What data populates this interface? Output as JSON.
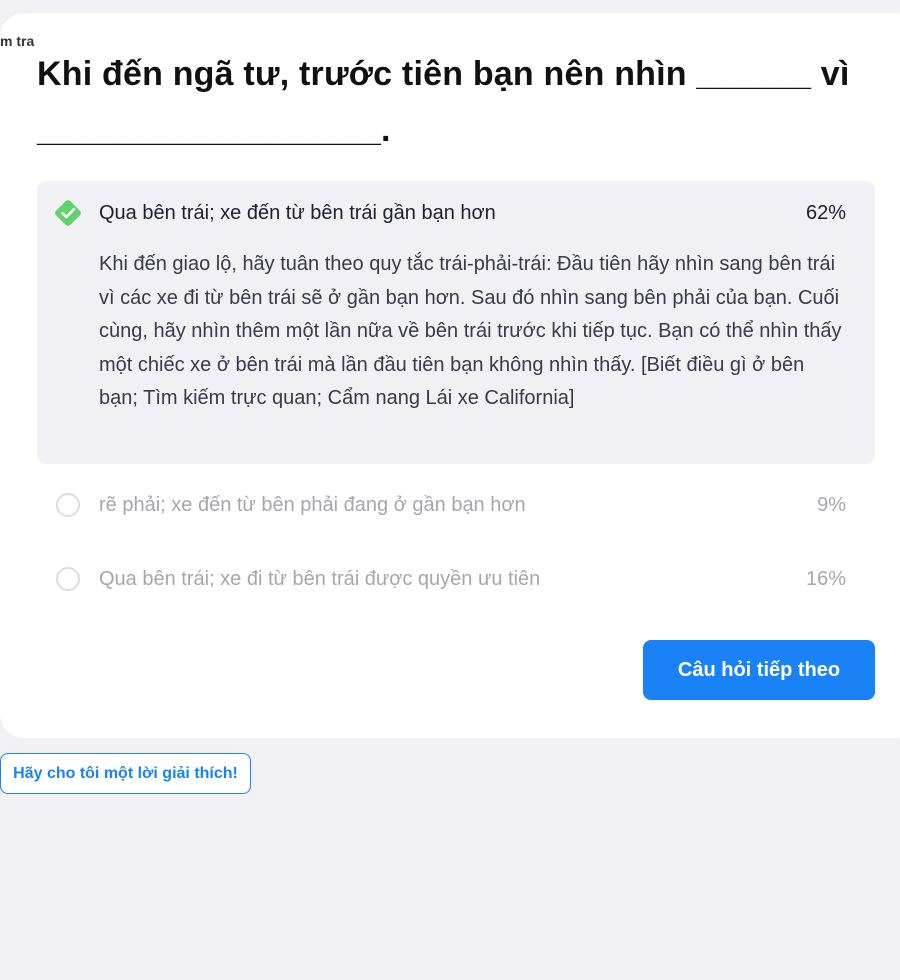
{
  "breadcrumb": "m tra",
  "question": "Khi đến ngã tư, trước tiên bạn nên nhìn ______ vì __________________.",
  "options": [
    {
      "label": "Qua bên trái; xe đến từ bên trái gần bạn hơn",
      "percent": "62%",
      "correct": true,
      "explanation": "Khi đến giao lộ, hãy tuân theo quy tắc trái-phải-trái: Đầu tiên hãy nhìn sang bên trái vì các xe đi từ bên trái sẽ ở gần bạn hơn. Sau đó nhìn sang bên phải của bạn. Cuối cùng, hãy nhìn thêm một lần nữa về bên trái trước khi tiếp tục. Bạn có thể nhìn thấy một chiếc xe ở bên trái mà lần đầu tiên bạn không nhìn thấy. [Biết điều gì ở bên bạn; Tìm kiếm trực quan; Cẩm nang Lái xe California]"
    },
    {
      "label": "rẽ phải; xe đến từ bên phải đang ở gần bạn hơn",
      "percent": "9%",
      "correct": false
    },
    {
      "label": "Qua bên trái; xe đi từ bên trái được quyền ưu tiên",
      "percent": "16%",
      "correct": false
    }
  ],
  "next_button": "Câu hỏi tiếp theo",
  "explain_button": "Hãy cho tôi một lời giải thích!",
  "icons": {
    "correct": "check-diamond-icon",
    "unselected": "radio-icon"
  },
  "colors": {
    "accent": "#1a82f7",
    "correct": "#5fd36a",
    "background": "#f0f0f5"
  }
}
